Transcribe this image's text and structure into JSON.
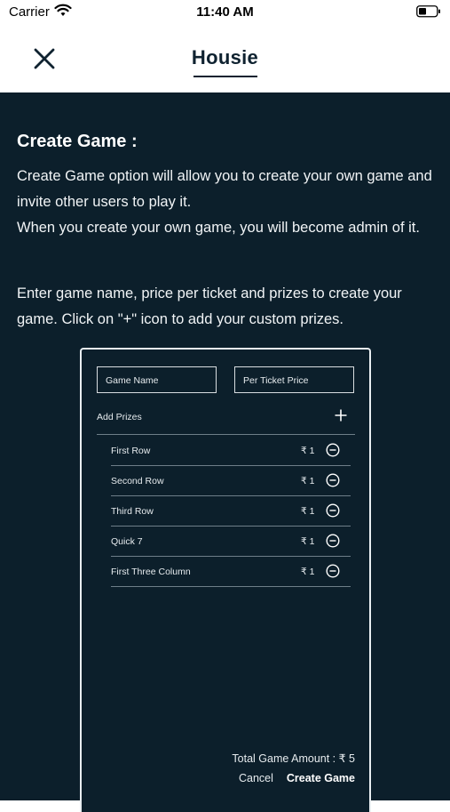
{
  "status_bar": {
    "carrier": "Carrier",
    "time": "11:40 AM",
    "icons": [
      "wifi-icon",
      "battery-icon"
    ]
  },
  "nav": {
    "title": "Housie",
    "close_icon": "close-icon"
  },
  "content": {
    "heading": "Create Game :",
    "paragraph1": "Create Game option will allow you to create your own game and invite other users to play it.",
    "paragraph2": "When you create your own game, you will become admin of it.",
    "paragraph3": "Enter game name, price per ticket and prizes to create your game. Click on \"+\" icon to add your custom prizes."
  },
  "mockup": {
    "game_name_placeholder": "Game Name",
    "ticket_price_placeholder": "Per Ticket Price",
    "add_prizes_label": "Add Prizes",
    "prizes": [
      {
        "label": "First Row",
        "amount": "₹ 1"
      },
      {
        "label": "Second Row",
        "amount": "₹ 1"
      },
      {
        "label": "Third Row",
        "amount": "₹ 1"
      },
      {
        "label": "Quick 7",
        "amount": "₹ 1"
      },
      {
        "label": "First Three Column",
        "amount": "₹ 1"
      }
    ],
    "total": "Total Game Amount : ₹ 5",
    "cancel_label": "Cancel",
    "create_label": "Create Game"
  },
  "colors": {
    "background_dark": "#0c1f2b",
    "nav_title": "#0f2230",
    "text_light": "#ffffff"
  }
}
